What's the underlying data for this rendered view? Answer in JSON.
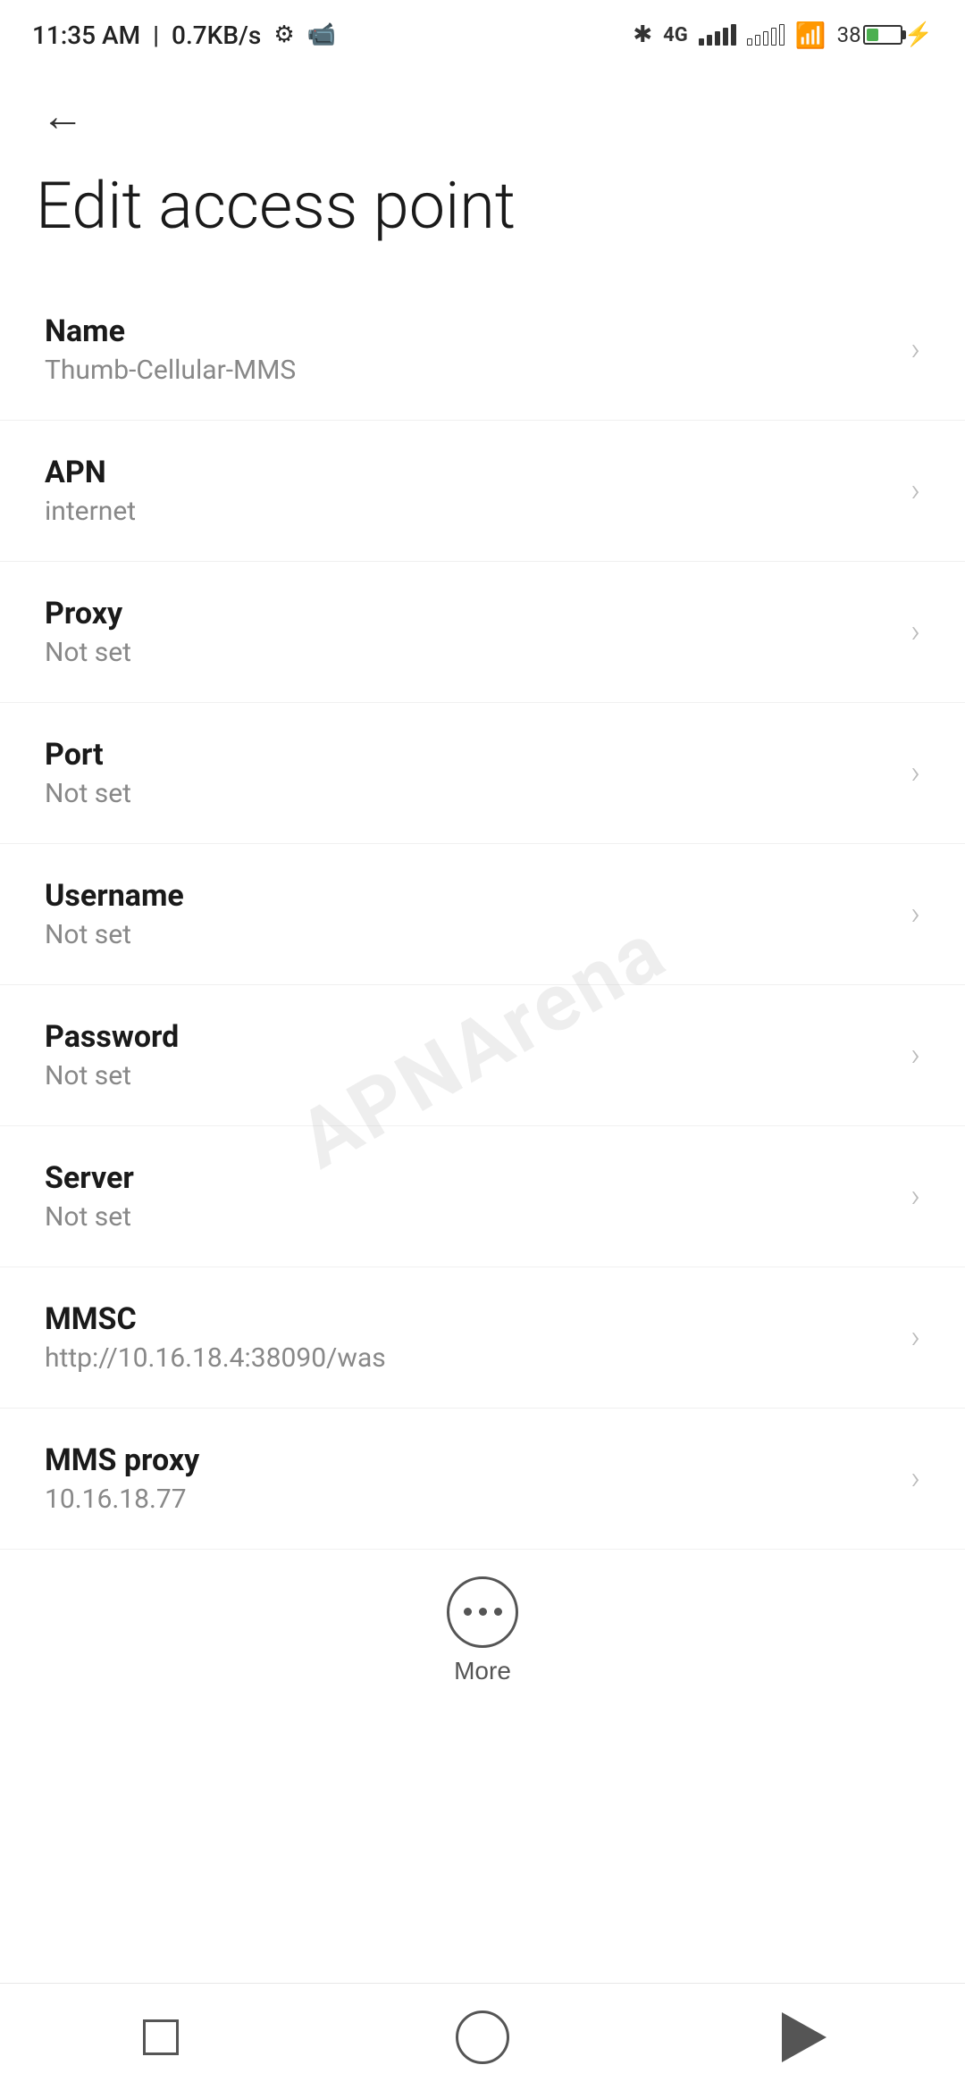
{
  "statusBar": {
    "time": "11:35 AM",
    "speed": "0.7KB/s",
    "battery": "38",
    "batteryCharging": true
  },
  "header": {
    "backLabel": "←",
    "title": "Edit access point"
  },
  "settings": {
    "items": [
      {
        "label": "Name",
        "value": "Thumb-Cellular-MMS"
      },
      {
        "label": "APN",
        "value": "internet"
      },
      {
        "label": "Proxy",
        "value": "Not set"
      },
      {
        "label": "Port",
        "value": "Not set"
      },
      {
        "label": "Username",
        "value": "Not set"
      },
      {
        "label": "Password",
        "value": "Not set"
      },
      {
        "label": "Server",
        "value": "Not set"
      },
      {
        "label": "MMSC",
        "value": "http://10.16.18.4:38090/was"
      },
      {
        "label": "MMS proxy",
        "value": "10.16.18.77"
      }
    ]
  },
  "bottomAction": {
    "moreLabel": "More"
  },
  "watermark": "APNArena"
}
